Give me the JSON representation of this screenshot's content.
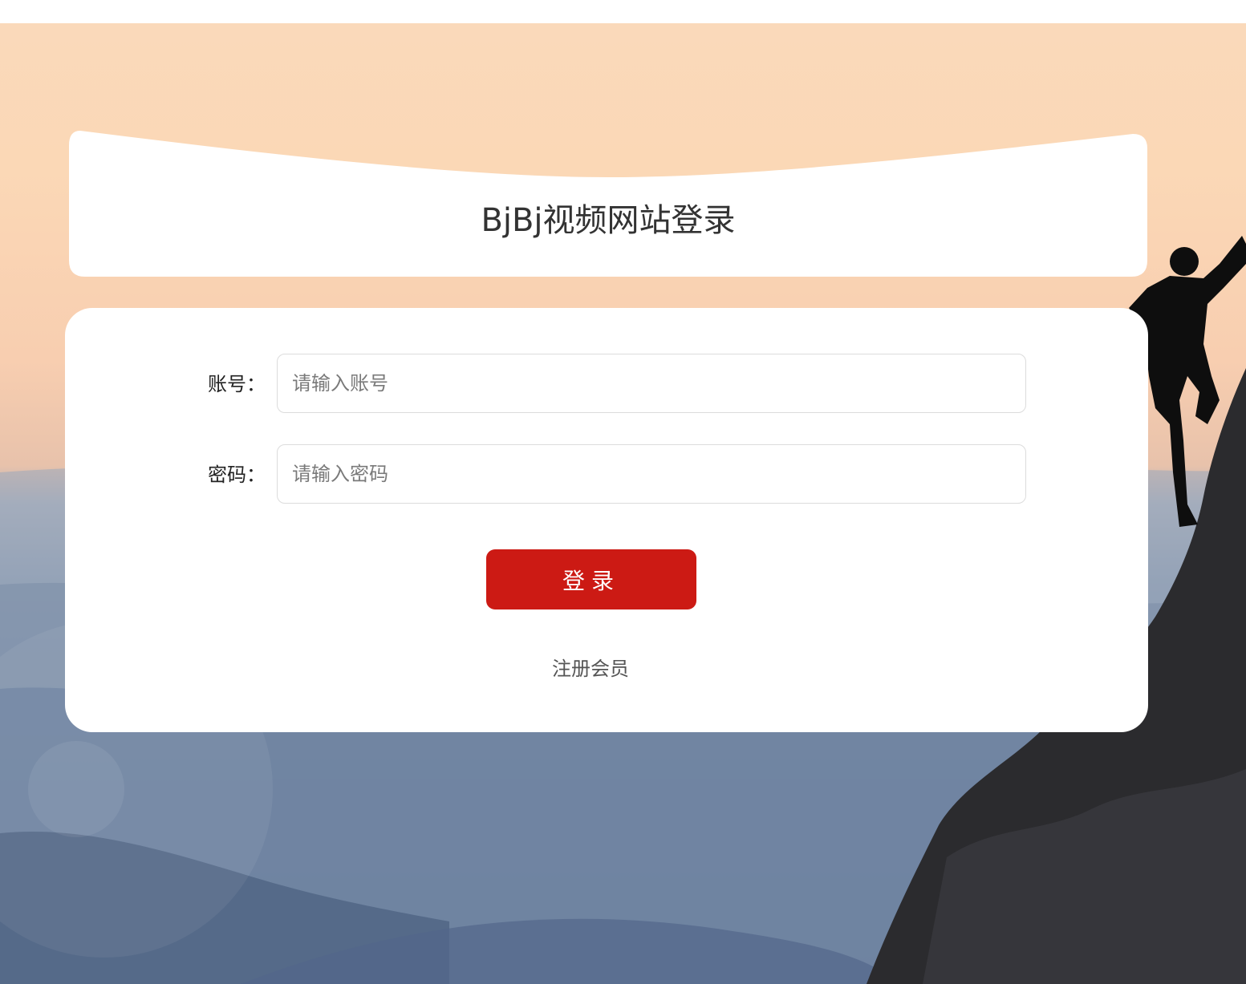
{
  "page": {
    "title": "BjBj视频网站登录"
  },
  "form": {
    "account_label": "账号：",
    "account_placeholder": "请输入账号",
    "password_label": "密码：",
    "password_placeholder": "请输入密码",
    "login_button": "登录",
    "register_link": "注册会员"
  },
  "colors": {
    "accent": "#cc1a14",
    "card": "#ffffff"
  }
}
